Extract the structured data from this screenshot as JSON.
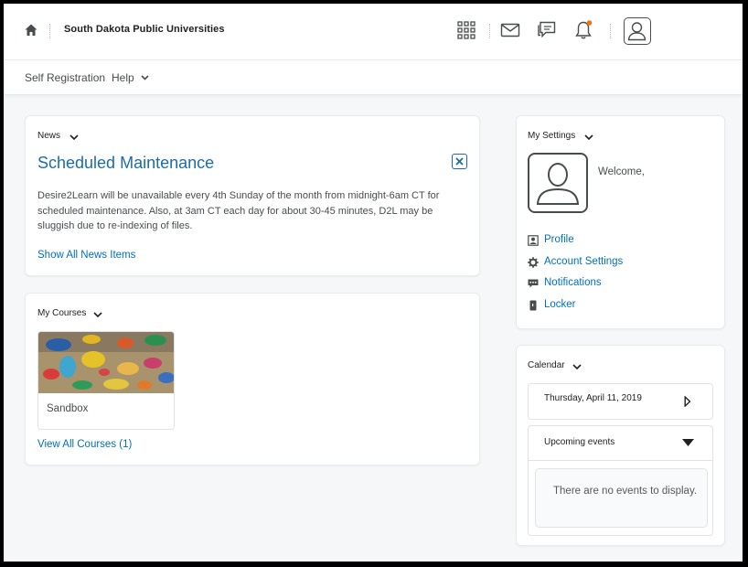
{
  "header": {
    "org_name": "South Dakota Public Universities",
    "icons": [
      "home-icon",
      "waffle-icon",
      "mail-icon",
      "chat-icon",
      "bell-icon",
      "avatar-icon"
    ],
    "notification_dot_color": "#e87511"
  },
  "nav": {
    "items": [
      {
        "label": "Self Registration"
      },
      {
        "label": "Help"
      }
    ]
  },
  "news": {
    "title": "News",
    "heading": "Scheduled Maintenance",
    "body": "Desire2Learn will be unavailable every 4th Sunday of the month from midnight-6am CT for scheduled maintenance.  Also, at 3am CT each day for about 30-45 minutes, D2L may be sluggish due to re-indexing of files.",
    "link": "Show All News Items"
  },
  "courses": {
    "title": "My Courses",
    "items": [
      {
        "name": "Sandbox"
      }
    ],
    "link": "View All Courses (1)"
  },
  "settings": {
    "title": "My Settings",
    "welcome": "Welcome,",
    "links": [
      {
        "label": "Profile",
        "icon": "profile-card-icon"
      },
      {
        "label": "Account Settings",
        "icon": "gear-icon"
      },
      {
        "label": "Notifications",
        "icon": "speech-bubble-icon"
      },
      {
        "label": "Locker",
        "icon": "locker-icon"
      }
    ]
  },
  "calendar": {
    "title": "Calendar",
    "date": "Thursday, April 11, 2019",
    "upcoming_label": "Upcoming events",
    "empty_text": "There are no events to display."
  },
  "colors": {
    "link": "#006fbf",
    "heading": "#1c6baa",
    "page_bg": "#f6f7f8"
  }
}
